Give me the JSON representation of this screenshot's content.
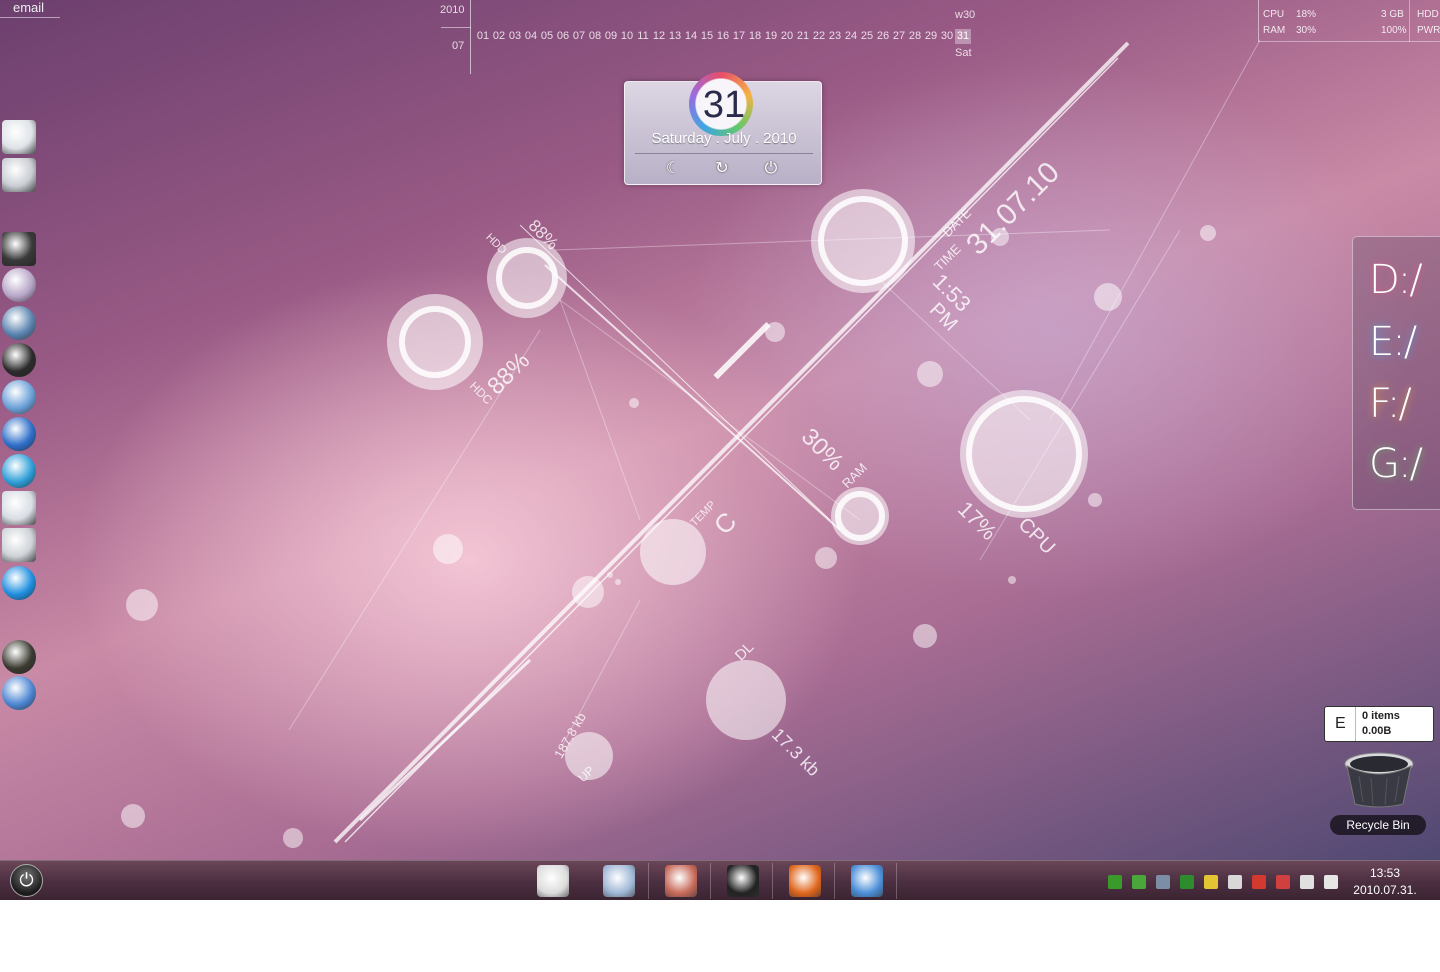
{
  "email_label": "email",
  "calendar": {
    "year": "2010",
    "month": "07",
    "days": [
      "01",
      "02",
      "03",
      "04",
      "05",
      "06",
      "07",
      "08",
      "09",
      "10",
      "11",
      "12",
      "13",
      "14",
      "15",
      "16",
      "17",
      "18",
      "19",
      "20",
      "21",
      "22",
      "23",
      "24",
      "25",
      "26",
      "27",
      "28",
      "29",
      "30",
      "31"
    ],
    "today": "31",
    "week": "w30",
    "weekday": "Sat"
  },
  "system_meter": {
    "cpu_label": "CPU",
    "cpu_value": "18%",
    "ram_label": "RAM",
    "ram_value": "30%",
    "mem_total": "3 GB",
    "power": "100%",
    "hdd_label": "HDD",
    "pwr_label": "PWR"
  },
  "date_widget": {
    "day": "31",
    "full_date": "Saturday . July . 2010",
    "sleep_icon": "moon-icon",
    "restart_icon": "restart-icon",
    "shutdown_icon": "power-icon"
  },
  "visualizer": {
    "date_label": "DATE",
    "date_value": "31.07.10",
    "time_label": "TIME",
    "time_value": "1:53",
    "time_ampm": "PM",
    "hdd_top_label": "HDD",
    "hdd_top_value": "88%",
    "hdc_label": "HDC",
    "hdc_value": "88%",
    "ram_label": "RAM",
    "ram_value": "30%",
    "temp_label": "TEMP",
    "temp_value": "C",
    "cpu_label": "CPU",
    "cpu_value": "17%",
    "dl_label": "DL",
    "dl_value": "17.3 kb",
    "up_label": "UP",
    "up_value": "187.8 kb"
  },
  "dock": [
    {
      "name": "computer-icon",
      "color": "#dfe3e8"
    },
    {
      "name": "drive-icon",
      "color": "#c9cdd3"
    },
    {
      "name": "cmd-icon",
      "color": "#3a3a3a"
    },
    {
      "name": "atom-icon",
      "color": "#b7a5c8"
    },
    {
      "name": "globe-icon",
      "color": "#5b84b0"
    },
    {
      "name": "headphones-icon",
      "color": "#2b2b2b"
    },
    {
      "name": "network-globe-icon",
      "color": "#6aa0d8"
    },
    {
      "name": "safari-compass-icon",
      "color": "#2e6fc9"
    },
    {
      "name": "media-player-icon",
      "color": "#2d9ed8"
    },
    {
      "name": "download-icon",
      "color": "#d8dde4"
    },
    {
      "name": "film-drive-icon",
      "color": "#cfd3d8"
    },
    {
      "name": "play-icon",
      "color": "#1f8fe0"
    },
    {
      "name": "pen-tool-icon",
      "color": "#3a3a30"
    },
    {
      "name": "settings-network-icon",
      "color": "#4d86d2"
    }
  ],
  "drives": [
    "D:/",
    "E:/",
    "F:/",
    "G:/"
  ],
  "recycle_bin": {
    "letter": "E",
    "items": "0 items",
    "size": "0.00B",
    "label": "Recycle Bin"
  },
  "taskbar": {
    "start_icon": "power-icon",
    "apps": [
      {
        "name": "film-reel-icon",
        "color": "#dcdcdc"
      },
      {
        "name": "water-drop-icon",
        "color": "#9fb7d6"
      },
      {
        "name": "users-icon",
        "color": "#c76a5a"
      },
      {
        "name": "clapper-icon",
        "color": "#222222"
      },
      {
        "name": "firefox-icon",
        "color": "#e0661c"
      },
      {
        "name": "control-panel-icon",
        "color": "#4b8fd8"
      }
    ],
    "tray": [
      {
        "name": "ovi-icon",
        "color": "#3b9b2a"
      },
      {
        "name": "shield-check-icon",
        "color": "#4aa83a"
      },
      {
        "name": "drop-icon",
        "color": "#7c8da6"
      },
      {
        "name": "green-box-icon",
        "color": "#2d8c2d"
      },
      {
        "name": "yellow-disc-icon",
        "color": "#e3c534"
      },
      {
        "name": "monitor-icon",
        "color": "#d8d8d8"
      },
      {
        "name": "opera-icon",
        "color": "#d23a2f"
      },
      {
        "name": "flag-x-icon",
        "color": "#d04040"
      },
      {
        "name": "network-icon",
        "color": "#e0e0e0"
      },
      {
        "name": "volume-icon",
        "color": "#e6e6e6"
      }
    ],
    "time": "13:53",
    "date": "2010.07.31."
  }
}
